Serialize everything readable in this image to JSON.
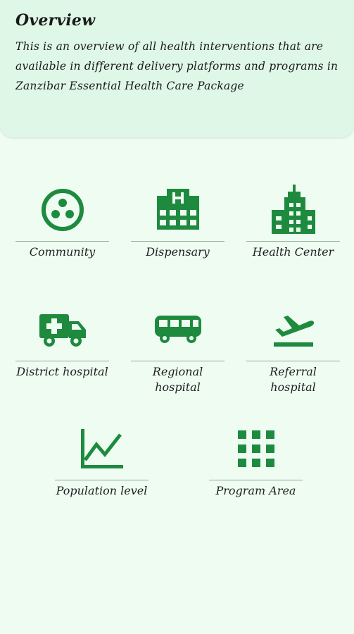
{
  "overview": {
    "title": "Overview",
    "description": "This is an overview of all health interventions that are available in different delivery platforms and programs in Zanzibar Essential Health Care Package"
  },
  "colors": {
    "accent": "#1e8a3e",
    "background": "#eefcf2",
    "card": "#dff7e6"
  },
  "tiles": [
    {
      "label": "Community",
      "icon": "community-icon"
    },
    {
      "label": "Dispensary",
      "icon": "hospital-building-icon"
    },
    {
      "label": "Health Center",
      "icon": "city-building-icon"
    },
    {
      "label": "District hospital",
      "icon": "ambulance-icon"
    },
    {
      "label": "Regional\nhospital",
      "icon": "bus-icon"
    },
    {
      "label": "Referral\nhospital",
      "icon": "flight-takeoff-icon"
    },
    {
      "label": "Population level",
      "icon": "line-chart-icon"
    },
    {
      "label": "Program Area",
      "icon": "grid-icon"
    }
  ]
}
